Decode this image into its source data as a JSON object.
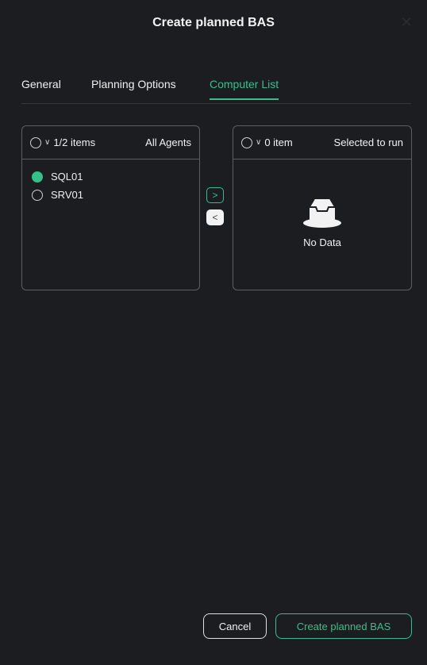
{
  "dialog": {
    "title": "Create planned BAS",
    "close_icon": "close-icon"
  },
  "tabs": [
    {
      "label": "General",
      "active": false
    },
    {
      "label": "Planning Options",
      "active": false
    },
    {
      "label": "Computer List",
      "active": true
    }
  ],
  "left_panel": {
    "count": "1/2 items",
    "title": "All Agents",
    "items": [
      {
        "label": "SQL01",
        "checked": true
      },
      {
        "label": "SRV01",
        "checked": false
      }
    ]
  },
  "transfer": {
    "to_right_icon": "chevron-right-icon",
    "to_left_icon": "chevron-left-icon"
  },
  "right_panel": {
    "count": "0 item",
    "title": "Selected to run",
    "empty_text": "No Data",
    "empty_icon": "empty-tray-icon"
  },
  "footer": {
    "cancel_label": "Cancel",
    "create_label": "Create planned BAS"
  },
  "colors": {
    "accent": "#35c08a",
    "background": "#1b1d20",
    "border": "#5b5f64"
  }
}
